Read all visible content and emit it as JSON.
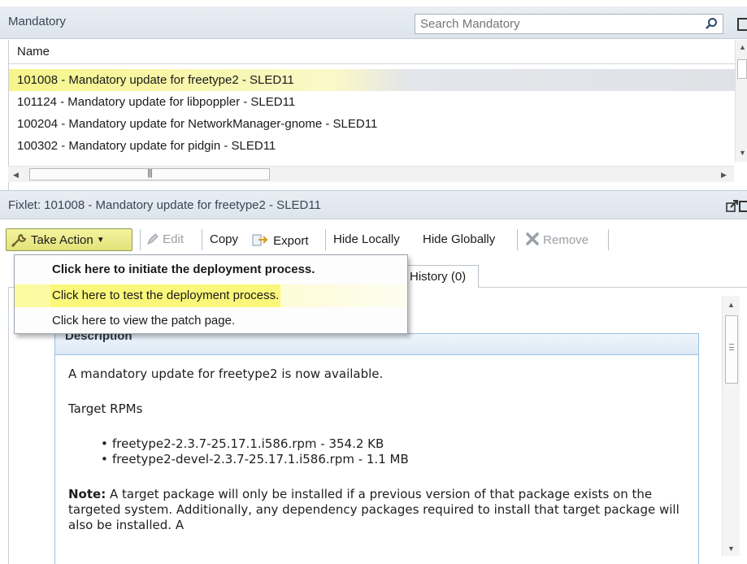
{
  "list_panel": {
    "title": "Mandatory",
    "search_placeholder": "Search Mandatory",
    "column_header": "Name",
    "rows": [
      "101008 - Mandatory update for freetype2 - SLED11",
      "101124 - Mandatory update for libpoppler - SLED11",
      "100204 - Mandatory update for NetworkManager-gnome - SLED11",
      "100302 - Mandatory update for pidgin - SLED11"
    ],
    "selected_row": 0
  },
  "fixlet_panel": {
    "title": "Fixlet: 101008 - Mandatory update for freetype2 - SLED11"
  },
  "toolbar": {
    "take_action": "Take Action",
    "edit": "Edit",
    "copy": "Copy",
    "export": "Export",
    "hide_locally": "Hide Locally",
    "hide_globally": "Hide Globally",
    "remove": "Remove"
  },
  "tabs": {
    "history": "History (0)"
  },
  "take_action_menu": [
    "Click here to initiate the deployment process.",
    "Click here to test the deployment process.",
    "Click here to view the patch page."
  ],
  "description": {
    "header": "Description",
    "intro": "A mandatory update for freetype2 is now available.",
    "target_label": "Target RPMs",
    "rpms": [
      "freetype2-2.3.7-25.17.1.i586.rpm - 354.2 KB",
      "freetype2-devel-2.3.7-25.17.1.i586.rpm - 1.1 MB"
    ],
    "note_label": "Note:",
    "note_text": " A target package will only be installed if a previous version of that package exists on the targeted system. Additionally, any dependency packages required to install that target package will also be installed. A"
  },
  "colors": {
    "highlight_yellow": "#f6f58a",
    "header_bg": "#e3e9f0",
    "description_border": "#9ac0e2"
  },
  "icons": {
    "search": "search-icon",
    "take_action": "wrench-icon",
    "edit": "pencil-icon",
    "export": "export-icon",
    "remove": "remove-x-icon",
    "popout": "popout-icon"
  }
}
